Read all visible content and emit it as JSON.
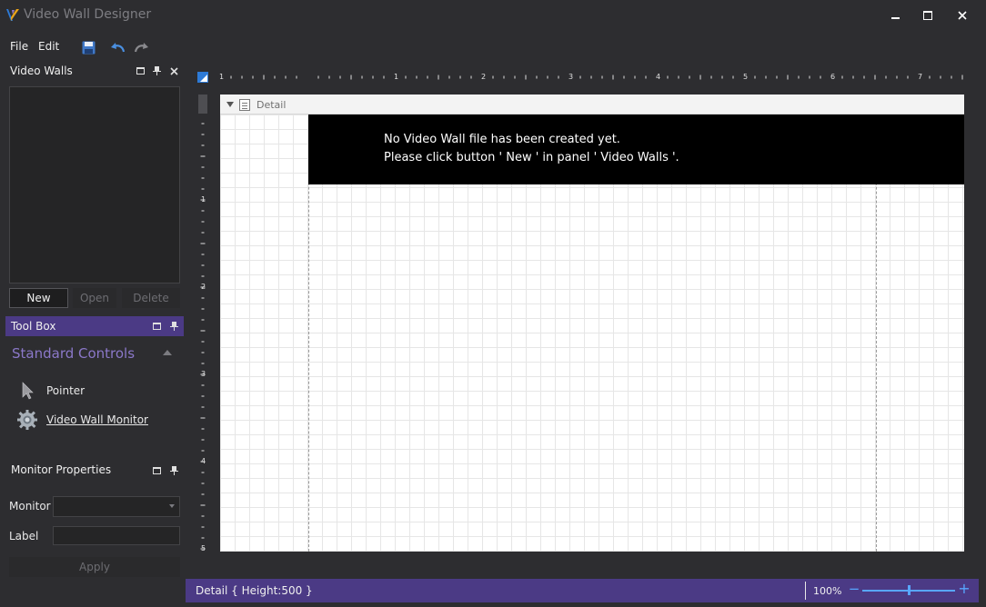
{
  "app": {
    "title": "Video Wall Designer",
    "window_controls": [
      "minimize",
      "maximize",
      "close"
    ]
  },
  "menu": {
    "file": "File",
    "edit": "Edit"
  },
  "toolbar": {
    "icons": [
      "save-icon",
      "undo-icon",
      "redo-icon"
    ]
  },
  "video_walls_panel": {
    "title": "Video Walls",
    "new_label": "New",
    "open_label": "Open",
    "delete_label": "Delete"
  },
  "toolbox": {
    "title": "Tool Box",
    "section": "Standard Controls",
    "items": [
      {
        "label": "Pointer",
        "icon": "pointer-icon"
      },
      {
        "label": "Video Wall Monitor",
        "icon": "monitor-gear-icon"
      }
    ]
  },
  "properties": {
    "title": "Monitor Properties",
    "monitor_label": "Monitor",
    "label_label": "Label",
    "monitor_value": "",
    "label_value": "",
    "apply_label": "Apply"
  },
  "designer": {
    "band_label": "Detail",
    "message_line1": "No Video Wall file has been created yet.",
    "message_line2": "Please click button ' New ' in panel ' Video Walls '.",
    "ruler_top_numbers": [
      "1",
      "1",
      "2",
      "3",
      "4",
      "5",
      "6",
      "7"
    ],
    "ruler_left_numbers": [
      "1",
      "2",
      "3",
      "4",
      "5"
    ]
  },
  "status": {
    "text": "Detail { Height:500 }",
    "zoom": "100%",
    "zoom_level": 0.5
  },
  "colors": {
    "background": "#2d2d30",
    "accent": "#4b3a85",
    "section_title": "#8b78c9",
    "zoom_blue": "#58a6ff",
    "ruler_corner": "#2d7ad6"
  }
}
